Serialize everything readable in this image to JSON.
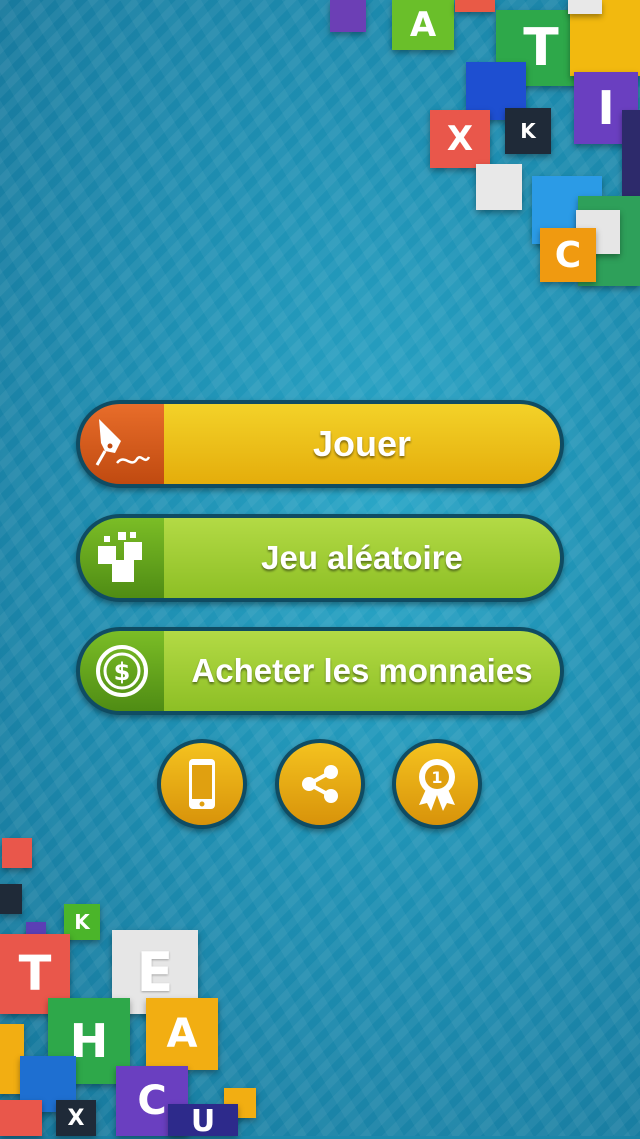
{
  "menu": {
    "play_label": "Jouer",
    "random_label": "Jeu aléatoire",
    "buy_coins_label": "Acheter les monnaies"
  },
  "tiles_top": [
    "A",
    "T",
    "I",
    "X",
    "K",
    "C"
  ],
  "tiles_bottom": [
    "K",
    "T",
    "E",
    "H",
    "A",
    "C",
    "X",
    "U"
  ],
  "icons": {
    "play": "pen-nib-icon",
    "random": "random-blocks-icon",
    "buy_coins": "dollar-coin-icon",
    "device": "phone-icon",
    "share": "share-icon",
    "ranking": "award-ribbon-icon"
  },
  "colors": {
    "background": "#1e8fb2",
    "play_button": "#f3d229",
    "green_button": "#a5d03b",
    "round_button": "#eeb718"
  }
}
